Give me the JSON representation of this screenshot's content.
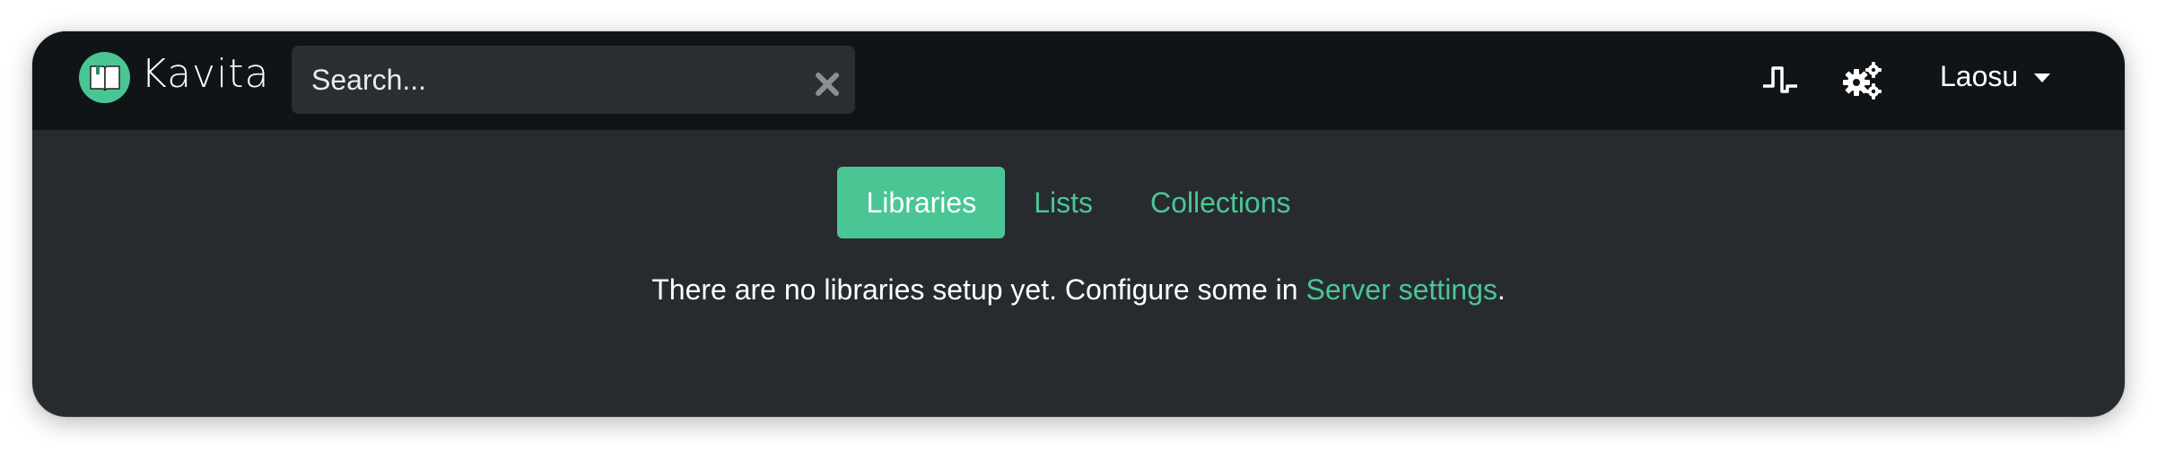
{
  "navbar": {
    "brand": "Kavita",
    "search": {
      "placeholder": "Search...",
      "value": ""
    },
    "user": "Laosu",
    "icons": [
      "book-logo-icon",
      "clear-icon",
      "activity-icon",
      "gears-icon",
      "caret-down-icon"
    ]
  },
  "tabs": [
    {
      "label": "Libraries",
      "active": true
    },
    {
      "label": "Lists",
      "active": false
    },
    {
      "label": "Collections",
      "active": false
    }
  ],
  "message": {
    "before": "There are no libraries setup yet. Configure some in ",
    "link": "Server settings",
    "after": "."
  },
  "colors": {
    "accent": "#4ac694",
    "navbar": "#111417",
    "content": "#272b30"
  }
}
